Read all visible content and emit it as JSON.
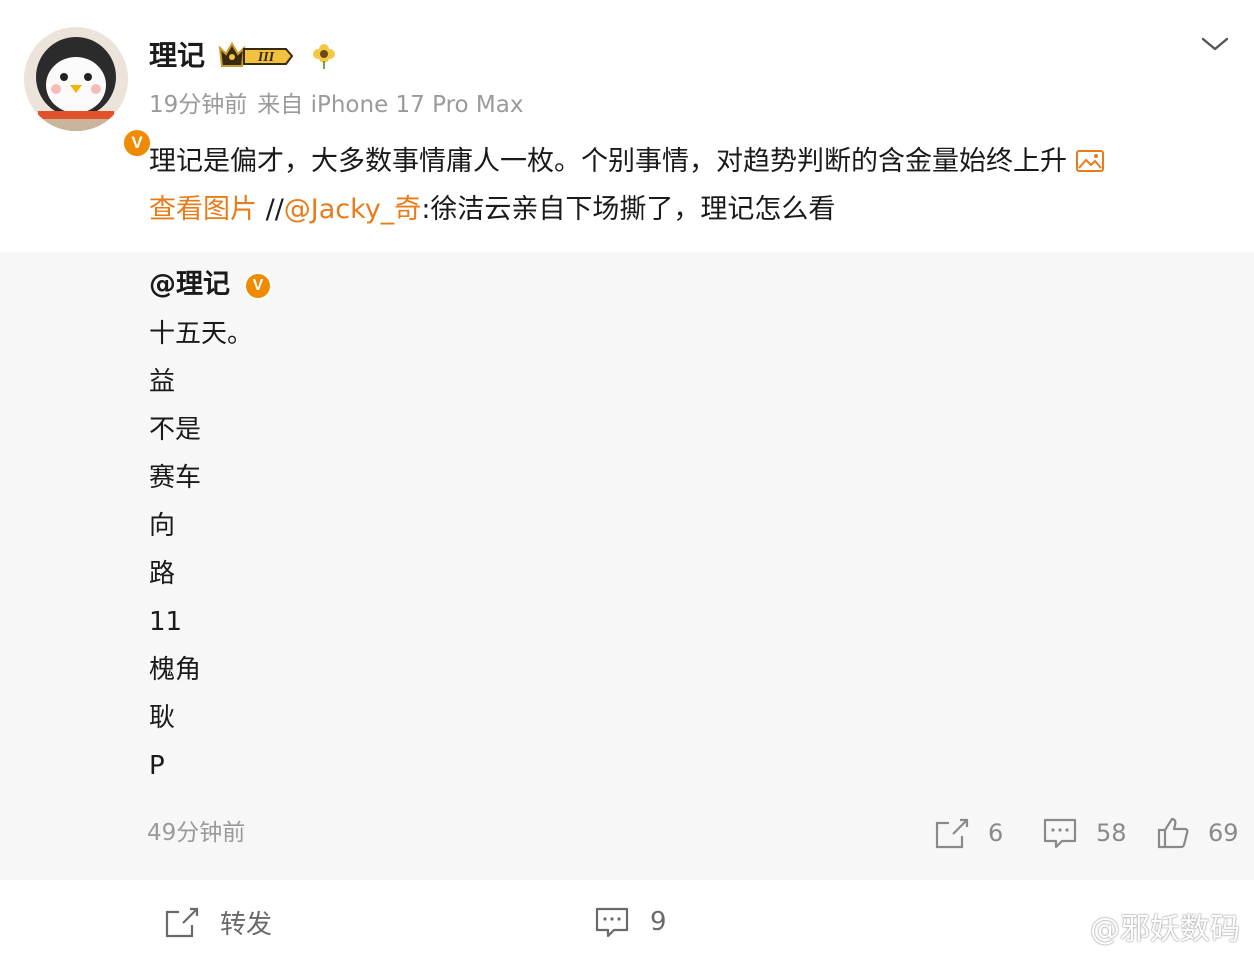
{
  "post": {
    "author": "理记",
    "member_badge": "III",
    "time": "19分钟前",
    "source": "来自 iPhone 17 Pro Max",
    "text": "理记是偏才，大多数事情庸人一枚。个别事情，对趋势判断的含金量始终上升",
    "view_image_link": "查看图片",
    "repost_prefix": "//",
    "mention": "@Jacky_奇",
    "repost_comment": ":徐洁云亲自下场撕了，理记怎么看",
    "verified_badge": "V"
  },
  "repost": {
    "author": "@理记",
    "verified_badge": "V",
    "lines": [
      "十五天。",
      "益",
      "不是",
      "赛车",
      "向",
      "路",
      "11",
      "槐角",
      "耿",
      "P"
    ],
    "time": "49分钟前",
    "shares": "6",
    "comments": "58",
    "likes": "69"
  },
  "actions": {
    "repost_label": "转发",
    "comment_count": "9"
  },
  "watermark": "@邪妖数码",
  "colors": {
    "accent_orange": "#e87c1a",
    "verified_orange": "#f08a00",
    "meta_gray": "#9a9a9a",
    "repost_bg": "#f7f7f7"
  }
}
